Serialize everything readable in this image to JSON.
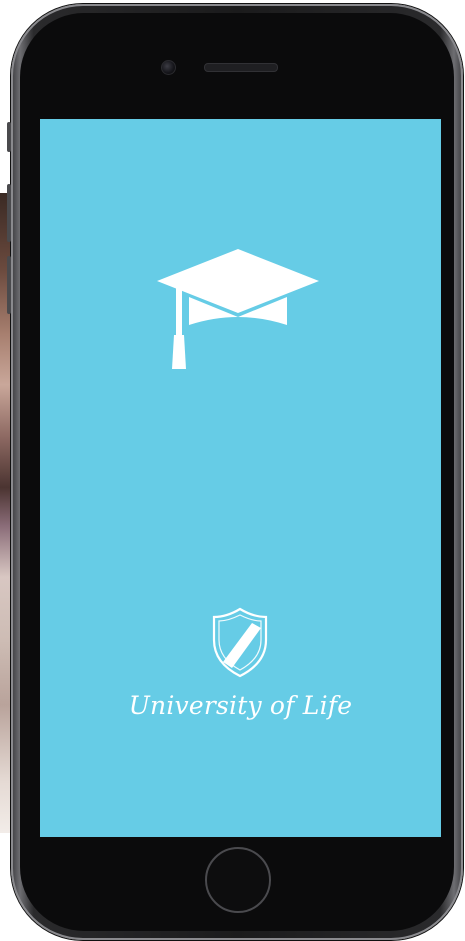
{
  "app": {
    "title": "University of Life",
    "background_color": "#66cce6",
    "icon_color": "#ffffff"
  },
  "icons": {
    "hero": "graduation-cap-icon",
    "logo": "shield-icon"
  },
  "device": {
    "model": "iphone-frame",
    "home_button": "home-button"
  }
}
